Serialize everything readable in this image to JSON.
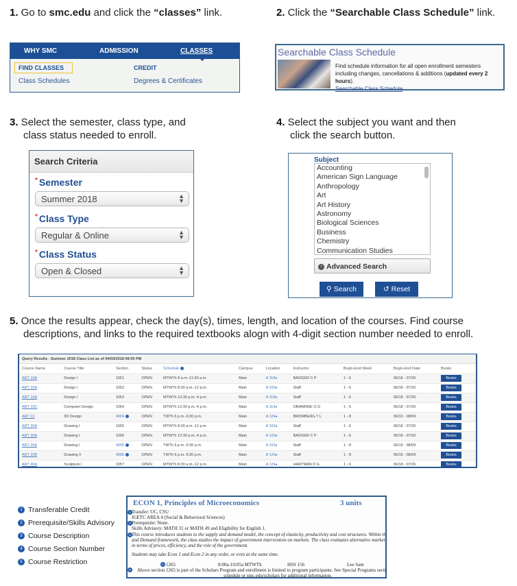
{
  "steps": {
    "s1": {
      "num": "1.",
      "pre": " Go to ",
      "b1": "smc.edu",
      "mid": " and click the ",
      "b2": "“classes”",
      "post": " link."
    },
    "s2": {
      "num": "2.",
      "pre": " Click the ",
      "b1": "“Searchable Class Schedule”",
      "post": " link."
    },
    "s3": {
      "num": "3.",
      "line1": " Select the semester, class type, and",
      "line2": "class status needed to enroll."
    },
    "s4": {
      "num": "4.",
      "line1": " Select the subject you want and then",
      "line2": "click the search button."
    },
    "s5": {
      "num": "5.",
      "line1": " Once the results appear, check the day(s), times, length, and location of the courses. Find course",
      "line2": "descriptions, and links to the required textbooks alogn with 4-digit section number needed to enroll."
    }
  },
  "nav": {
    "top": [
      "WHY SMC",
      "ADMISSION",
      "CLASSES"
    ],
    "find_classes": "FIND CLASSES",
    "credit": "CREDIT",
    "class_schedules": "Class Schedules",
    "degrees": "Degrees & Certificates"
  },
  "scs": {
    "title": "Searchable Class Schedule",
    "desc1": "Find schedule information for all open enrollment semesters including changes, cancellations & additions (",
    "desc_bold": "updated every 2 hours",
    "desc2": ").",
    "link": "Searchable Class Schedule",
    "period": "."
  },
  "criteria": {
    "header": "Search Criteria",
    "fields": [
      {
        "label": "Semester",
        "value": "Summer 2018"
      },
      {
        "label": "Class Type",
        "value": "Regular & Online"
      },
      {
        "label": "Class Status",
        "value": "Open & Closed"
      }
    ],
    "req": "*"
  },
  "subject": {
    "label": "Subject",
    "options": [
      "Accounting",
      "American Sign Language",
      "Anthropology",
      "Art",
      "Art History",
      "Astronomy",
      "Biological Sciences",
      "Business",
      "Chemistry",
      "Communication Studies"
    ],
    "advanced": "Advanced Search",
    "search": "Search",
    "reset": "Reset"
  },
  "results": {
    "title": "Query Results  -  Summer 2018 Class List as of 04/03/2018 08:05 PM",
    "columns": [
      "Course Name",
      "Course Title",
      "Section",
      "Status",
      "Schedule",
      "Campus",
      "Location",
      "Instructor",
      "Begin-End Week",
      "Begin-End Date",
      "Books"
    ],
    "rows": [
      {
        "name": "ART 10A",
        "title": "Design I",
        "section": "1051",
        "info": false,
        "status": "OPEN",
        "schedule": "MTWTh 8 a.m.-11:30 a.m.",
        "campus": "Main",
        "location": "A 118",
        "instructor": "BADGER C P",
        "week": "1 - 6",
        "date": "06/18 - 07/26",
        "books": "Books"
      },
      {
        "name": "ART 10A",
        "title": "Design I",
        "section": "1052",
        "info": false,
        "status": "OPEN",
        "schedule": "MTWTh 8:30 a.m.-12 p.m.",
        "campus": "Main",
        "location": "A 220",
        "instructor": "Staff",
        "week": "1 - 6",
        "date": "06/18 - 07/26",
        "books": "Books"
      },
      {
        "name": "ART 10A",
        "title": "Design I",
        "section": "1053",
        "info": false,
        "status": "OPEN",
        "schedule": "MTWTh 12:30 p.m.-4 p.m.",
        "campus": "Main",
        "location": "A 118",
        "instructor": "Staff",
        "week": "1 - 6",
        "date": "06/18 - 07/26",
        "books": "Books"
      },
      {
        "name": "ART 10C",
        "title": "Computer Design",
        "section": "1054",
        "info": false,
        "status": "OPEN",
        "schedule": "MTWTh 12:30 p.m.-4 p.m.",
        "campus": "Main",
        "location": "A 119",
        "instructor": "OBIAMIWE O D",
        "week": "1 - 6",
        "date": "06/18 - 07/26",
        "books": "Books"
      },
      {
        "name": "ART 13",
        "title": "3D Design",
        "section": "4004",
        "info": true,
        "status": "OPEN",
        "schedule": "TWTh 6 p.m.-9:30 p.m.",
        "campus": "Main",
        "location": "A 124",
        "instructor": "BROMBERG T L",
        "week": "1 - 8",
        "date": "06/19 - 08/09",
        "books": "Books"
      },
      {
        "name": "ART 20A",
        "title": "Drawing I",
        "section": "1055",
        "info": false,
        "status": "OPEN",
        "schedule": "MTWTh 8:30 a.m.-12 p.m.",
        "campus": "Main",
        "location": "A 102",
        "instructor": "Staff",
        "week": "1 - 6",
        "date": "06/18 - 07/26",
        "books": "Books"
      },
      {
        "name": "ART 20A",
        "title": "Drawing I",
        "section": "1056",
        "info": false,
        "status": "OPEN",
        "schedule": "MTWTh 12:30 p.m.-4 p.m.",
        "campus": "Main",
        "location": "A 120",
        "instructor": "BADGER C P",
        "week": "1 - 6",
        "date": "06/18 - 07/26",
        "books": "Books"
      },
      {
        "name": "ART 20A",
        "title": "Drawing I",
        "section": "4005",
        "info": true,
        "status": "OPEN",
        "schedule": "TWTh 6 p.m.-9:30 p.m.",
        "campus": "Main",
        "location": "A 102",
        "instructor": "Staff",
        "week": "1 - 8",
        "date": "06/19 - 08/09",
        "books": "Books"
      },
      {
        "name": "ART 20B",
        "title": "Drawing II",
        "section": "4006",
        "info": true,
        "status": "OPEN",
        "schedule": "TWTh 6 p.m.-9:30 p.m.",
        "campus": "Main",
        "location": "A 120",
        "instructor": "Staff",
        "week": "1 - 8",
        "date": "06/19 - 08/09",
        "books": "Books"
      },
      {
        "name": "ART 40A",
        "title": "Sculpture I",
        "section": "1057",
        "info": false,
        "status": "OPEN",
        "schedule": "MTWTh 8:30 a.m.-12 p.m.",
        "campus": "Main",
        "location": "A 124",
        "instructor": "HARTMAN D G",
        "week": "1 - 6",
        "date": "06/18 - 07/26",
        "books": "Books"
      }
    ]
  },
  "legend": [
    {
      "n": "1",
      "label": "Transferable Credit"
    },
    {
      "n": "2",
      "label": "Prerequisite/Skills Advisory"
    },
    {
      "n": "3",
      "label": "Course Description"
    },
    {
      "n": "4",
      "label": "Course Section Number"
    },
    {
      "n": "5",
      "label": "Course Restriction"
    }
  ],
  "econ": {
    "title": "ECON 1, Principles of Microeconomics",
    "units": "3 units",
    "transfer": "Transfer: UC, CSU",
    "igetc": "IGETC AREA 4 (Social & Behavioral Sciences)",
    "prereq": "Prerequisite: None.",
    "skills": "Skills Advisory: MATH 31 or MATH 49 and Eligibility for English 1.",
    "desc1": "This course introduces students to the supply and demand model, the concept of elasticity, productivity and cost structures. Within the Supply",
    "desc2": "and Demand framework, the class studies the impact of government intervention on markets. The class evaluates alternative market structures",
    "desc3": "in terms of prices, efficiency, and the role of the government.",
    "note": "Students may take Econ 1 and Econ 2 in any order, or even at the same time.",
    "section": "1265",
    "time": "8:00a-10:05a MTWTh",
    "room": "HSS 156",
    "instructor": "Lee Sam",
    "restr1": "Above section 1265 is part of the Scholars Program and enrollment is limited to program participants. See Special Programs section of class",
    "restr2": "schedule or smc.edu/scholars for additional information."
  }
}
